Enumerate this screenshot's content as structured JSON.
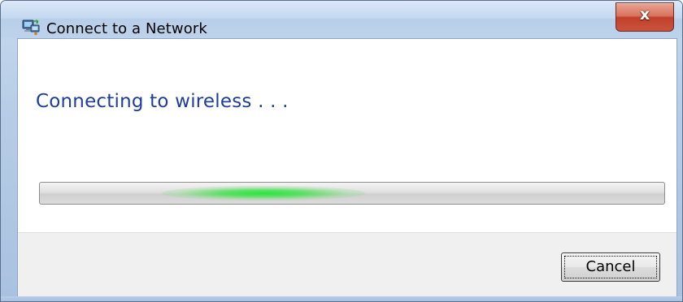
{
  "window": {
    "title": "Connect to a Network",
    "close_glyph": "x",
    "icon": "network-connection-icon"
  },
  "main": {
    "heading": "Connecting to wireless . . ."
  },
  "progress": {
    "state": "indeterminate",
    "color": "#28e63c"
  },
  "footer": {
    "cancel_label": "Cancel"
  },
  "colors": {
    "heading_text": "#1e3d9c",
    "close_button": "#c9533d",
    "footer_background": "#f0f0f0"
  }
}
